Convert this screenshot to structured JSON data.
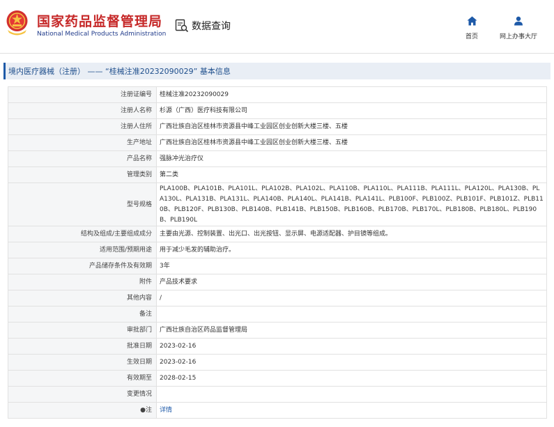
{
  "header": {
    "brand_cn": "国家药品监督管理局",
    "brand_en": "National Medical Products Administration",
    "query_label": "数据查询",
    "nav_home": "首页",
    "nav_hall": "网上办事大厅",
    "accent_color": "#c62828",
    "link_color": "#1e5aa8"
  },
  "breadcrumb": {
    "text": "境内医疗器械（注册） —— “桂械注准20232090029” 基本信息"
  },
  "rows": [
    {
      "label": "注册证编号",
      "value": "桂械注准20232090029"
    },
    {
      "label": "注册人名称",
      "value": "杉源（广西）医疗科技有限公司"
    },
    {
      "label": "注册人住所",
      "value": "广西壮族自治区桂林市资源县中峰工业园区创业创新大楼三楼、五楼"
    },
    {
      "label": "生产地址",
      "value": "广西壮族自治区桂林市资源县中峰工业园区创业创新大楼三楼、五楼"
    },
    {
      "label": "产品名称",
      "value": "强脉冲光治疗仪"
    },
    {
      "label": "管理类别",
      "value": "第二类"
    },
    {
      "label": "型号规格",
      "value": "PLA100B、PLA101B、PLA101L、PLA102B、PLA102L、PLA110B、PLA110L、PLA111B、PLA111L、PLA120L、PLA130B、PLA130L、PLA131B、PLA131L、PLA140B、PLA140L、PLA141B、PLA141L、PLB100F、PLB100Z、PLB101F、PLB101Z、PLB110B、PLB120F、PLB130B、PLB140B、PLB141B、PLB150B、PLB160B、PLB170B、PLB170L、PLB180B、PLB180L、PLB190B、PLB190L"
    },
    {
      "label": "结构及组成/主要组成成分",
      "value": "主要由光源、控制装置、出光口、出光按钮、显示屏、电源适配器、护目镜等组成。"
    },
    {
      "label": "适用范围/预期用途",
      "value": "用于减少毛发的辅助治疗。"
    },
    {
      "label": "产品储存条件及有效期",
      "value": "3年"
    },
    {
      "label": "附件",
      "value": "产品技术要求"
    },
    {
      "label": "其他内容",
      "value": "/"
    },
    {
      "label": "备注",
      "value": ""
    },
    {
      "label": "审批部门",
      "value": "广西壮族自治区药品监督管理局"
    },
    {
      "label": "批准日期",
      "value": "2023-02-16"
    },
    {
      "label": "生效日期",
      "value": "2023-02-16"
    },
    {
      "label": "有效期至",
      "value": "2028-02-15"
    },
    {
      "label": "变更情况",
      "value": ""
    },
    {
      "label": "●注",
      "value": "详情"
    }
  ]
}
